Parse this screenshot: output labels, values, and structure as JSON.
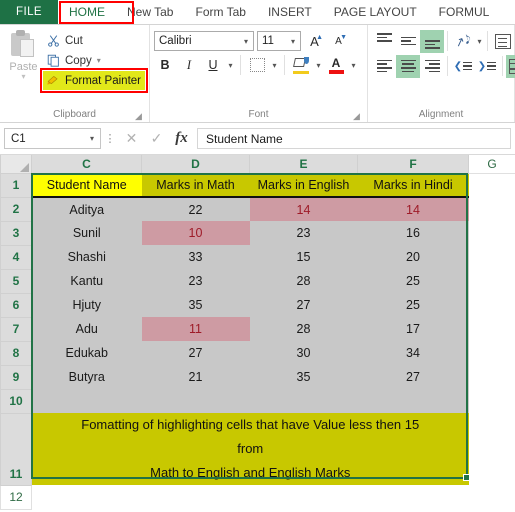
{
  "tabs": {
    "file": "FILE",
    "items": [
      {
        "label": "HOME",
        "active": true,
        "highlighted": true
      },
      {
        "label": "New Tab",
        "active": false,
        "highlighted": false
      },
      {
        "label": "Form Tab",
        "active": false,
        "highlighted": false
      },
      {
        "label": "INSERT",
        "active": false,
        "highlighted": false
      },
      {
        "label": "PAGE LAYOUT",
        "active": false,
        "highlighted": false
      },
      {
        "label": "FORMUL",
        "active": false,
        "highlighted": false
      }
    ]
  },
  "ribbon": {
    "clipboard": {
      "group_label": "Clipboard",
      "paste_label": "Paste",
      "cut_label": "Cut",
      "copy_label": "Copy",
      "format_painter_label": "Format Painter",
      "highlight_color": "#e2e81a",
      "annotation_color": "#ff0000"
    },
    "font": {
      "group_label": "Font",
      "font_name": "Calibri",
      "font_size": "11",
      "bold_label": "B",
      "italic_label": "I",
      "underline_label": "U",
      "grow_font_label": "A",
      "shrink_font_label": "A",
      "font_color_accent": "#ee1111",
      "fill_color_accent": "#f2cb1d"
    },
    "alignment": {
      "group_label": "Alignment",
      "active_accent": "#9fd2b0"
    }
  },
  "formula_bar": {
    "name_box": "C1",
    "cancel_label": "✕",
    "enter_label": "✓",
    "function_label": "fx",
    "content": "Student Name"
  },
  "sheet": {
    "columns": [
      "C",
      "D",
      "E",
      "F",
      "G"
    ],
    "row_numbers": [
      "1",
      "2",
      "3",
      "4",
      "5",
      "6",
      "7",
      "8",
      "9",
      "10",
      "11",
      "12"
    ],
    "headers": [
      "Student Name",
      "Marks in Math",
      "Marks in English",
      "Marks in Hindi"
    ],
    "header_colors": [
      "#ffff00",
      "#c8c800",
      "#c8c800",
      "#c8c800"
    ],
    "rows": [
      {
        "row": "2",
        "name": "Aditya",
        "math": "22",
        "english": "14",
        "hindi": "14",
        "flags": [
          "english",
          "hindi"
        ]
      },
      {
        "row": "3",
        "name": "Sunil",
        "math": "10",
        "english": "23",
        "hindi": "16",
        "flags": [
          "math"
        ]
      },
      {
        "row": "4",
        "name": "Shashi",
        "math": "33",
        "english": "15",
        "hindi": "20",
        "flags": []
      },
      {
        "row": "5",
        "name": "Kantu",
        "math": "23",
        "english": "28",
        "hindi": "25",
        "flags": []
      },
      {
        "row": "6",
        "name": "Hjuty",
        "math": "35",
        "english": "27",
        "hindi": "25",
        "flags": []
      },
      {
        "row": "7",
        "name": "Adu",
        "math": "11",
        "english": "28",
        "hindi": "17",
        "flags": [
          "math"
        ]
      },
      {
        "row": "8",
        "name": "Edukab",
        "math": "27",
        "english": "30",
        "hindi": "34",
        "flags": []
      },
      {
        "row": "9",
        "name": "Butyra",
        "math": "21",
        "english": "35",
        "hindi": "27",
        "flags": []
      }
    ],
    "note_line1": "Fomatting of highlighting cells that have Value less then 15",
    "note_line2": "from",
    "note_line3": "Math to English and English Marks",
    "note_background": "#c8c800",
    "selection_color": "#217346",
    "highlight_cell_background": "#ce9ba3",
    "highlight_cell_text": "#9e1b28",
    "data_background": "#c8c8c8"
  }
}
